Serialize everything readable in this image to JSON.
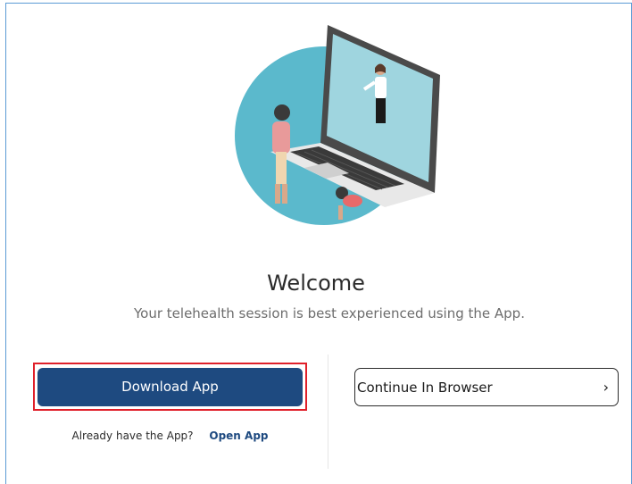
{
  "welcome": {
    "title": "Welcome",
    "subtitle": "Your telehealth session is best experienced using the App."
  },
  "actions": {
    "download_label": "Download App",
    "already_have_text": "Already have the App?",
    "open_app_label": "Open App",
    "continue_label": "Continue In Browser",
    "chevron_glyph": "›"
  },
  "colors": {
    "primary": "#1e4a80",
    "highlight": "#e0202a",
    "circle": "#5bb9cc"
  },
  "icons": {
    "illustration": "telehealth-laptop-illustration",
    "chevron": "chevron-right-icon"
  }
}
